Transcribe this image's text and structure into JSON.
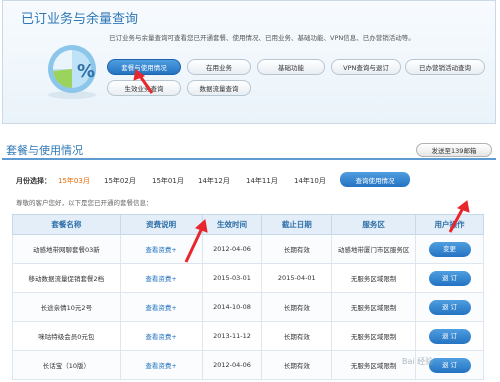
{
  "header": {
    "title": "已订业务与余量查询",
    "description": "已订业务与余量查询可查看您已开通套餐、使用情况、已用业务、基础功能、VPN信息、已办营销活动等。"
  },
  "tabs": [
    {
      "label": "套餐与使用情况",
      "active": true
    },
    {
      "label": "在用业务"
    },
    {
      "label": "基础功能"
    },
    {
      "label": "VPN查询与退订"
    },
    {
      "label": "已办营销活动查询"
    },
    {
      "label": "生效业务查询"
    },
    {
      "label": "数据流量查询"
    }
  ],
  "section": {
    "title": "套餐与使用情况",
    "send_button": "发送至139邮箱",
    "month_label": "月份选择：",
    "months": [
      "15年03月",
      "15年02月",
      "15年01月",
      "14年12月",
      "14年11月",
      "14年10月"
    ],
    "query_button": "查询使用情况",
    "notice": "尊敬的客户您好，以下是您已开通的套餐信息："
  },
  "table": {
    "headers": [
      "套餐名称",
      "资费说明",
      "生效时间",
      "截止日期",
      "服务区",
      "用户操作"
    ],
    "rows": [
      {
        "name": "动感地带网聊套餐03新",
        "fee": "查看资费+",
        "start": "2012-04-06",
        "end": "长期有效",
        "area": "动感地带厦门市区服务区",
        "action": "变更"
      },
      {
        "name": "移动数据流量促销套餐2档",
        "fee": "查看资费+",
        "start": "2015-03-01",
        "end": "2015-04-01",
        "area": "无服务区域限制",
        "action": "退 订"
      },
      {
        "name": "长途亲情10元2号",
        "fee": "查看资费+",
        "start": "2014-10-08",
        "end": "长期有效",
        "area": "无服务区域限制",
        "action": "退 订"
      },
      {
        "name": "咪咕特级会员0元包",
        "fee": "查看资费+",
        "start": "2013-11-12",
        "end": "长期有效",
        "area": "无服务区域限制",
        "action": "退 订"
      },
      {
        "name": "长话宝（10版）",
        "fee": "查看资费+",
        "start": "2012-04-06",
        "end": "长期有效",
        "area": "无服务区域限制",
        "action": "退 订"
      }
    ]
  },
  "watermark": "Bai 经验",
  "colors": {
    "accent": "#2f78b6",
    "button": "#2373c2",
    "arrow": "#e8262b",
    "selected_month": "#e36c09"
  }
}
